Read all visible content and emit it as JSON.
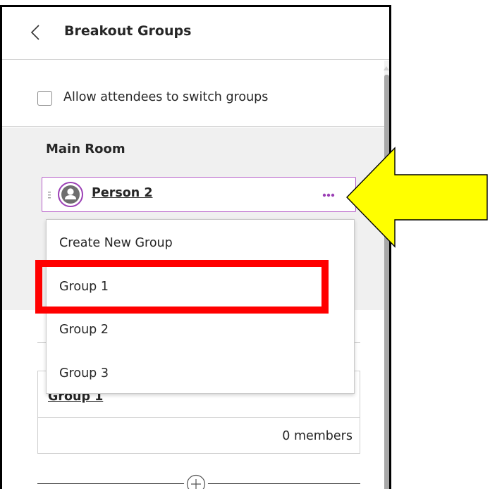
{
  "header": {
    "title": "Breakout Groups"
  },
  "allow_switch": {
    "label": "Allow attendees to switch groups",
    "checked": false
  },
  "main_room": {
    "title": "Main Room",
    "attendee": {
      "name": "Person 2"
    }
  },
  "menu": {
    "items": [
      {
        "label": "Create New Group"
      },
      {
        "label": "Group 1"
      },
      {
        "label": "Group 2"
      },
      {
        "label": "Group 3"
      }
    ]
  },
  "group_card": {
    "name": "Group 1",
    "members": "0 members"
  },
  "colors": {
    "accent": "#9b3fb5",
    "highlight": "#ff0000",
    "arrow_fill": "#ffff00"
  }
}
